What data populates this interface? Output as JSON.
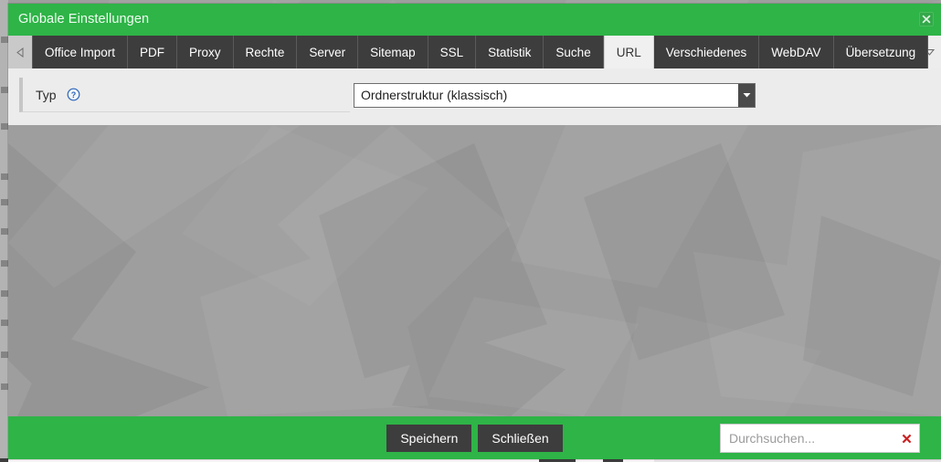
{
  "window": {
    "title": "Globale Einstellungen",
    "close_icon": "close-x-icon",
    "accent_green": "#2eb447",
    "tabbar_bg": "#3d3d3d",
    "active_tab_bg": "#f0f0f0"
  },
  "tabbar": {
    "scroll_left_icon": "chevron-left-icon",
    "scroll_right_icon": "chevron-right-icon",
    "menu_icon": "chevron-down-icon",
    "active_tab": "URL",
    "tabs": [
      {
        "label": "Office Import",
        "active": false
      },
      {
        "label": "PDF",
        "active": false
      },
      {
        "label": "Proxy",
        "active": false
      },
      {
        "label": "Rechte",
        "active": false
      },
      {
        "label": "Server",
        "active": false
      },
      {
        "label": "Sitemap",
        "active": false
      },
      {
        "label": "SSL",
        "active": false
      },
      {
        "label": "Statistik",
        "active": false
      },
      {
        "label": "Suche",
        "active": false
      },
      {
        "label": "URL",
        "active": true
      },
      {
        "label": "Verschiedenes",
        "active": false
      },
      {
        "label": "WebDAV",
        "active": false
      },
      {
        "label": "Übersetzung",
        "active": false
      }
    ]
  },
  "form": {
    "type_row": {
      "label": "Typ",
      "help_icon": "help-question-icon",
      "select_value": "Ordnerstruktur (klassisch)",
      "select_arrow_icon": "caret-down-icon",
      "options": [
        "Ordnerstruktur (klassisch)"
      ]
    }
  },
  "footer": {
    "save_label": "Speichern",
    "close_label": "Schließen",
    "search": {
      "value": "",
      "placeholder": "Durchsuchen...",
      "clear_icon": "clear-x-icon",
      "clear_color": "#cc2121"
    }
  }
}
